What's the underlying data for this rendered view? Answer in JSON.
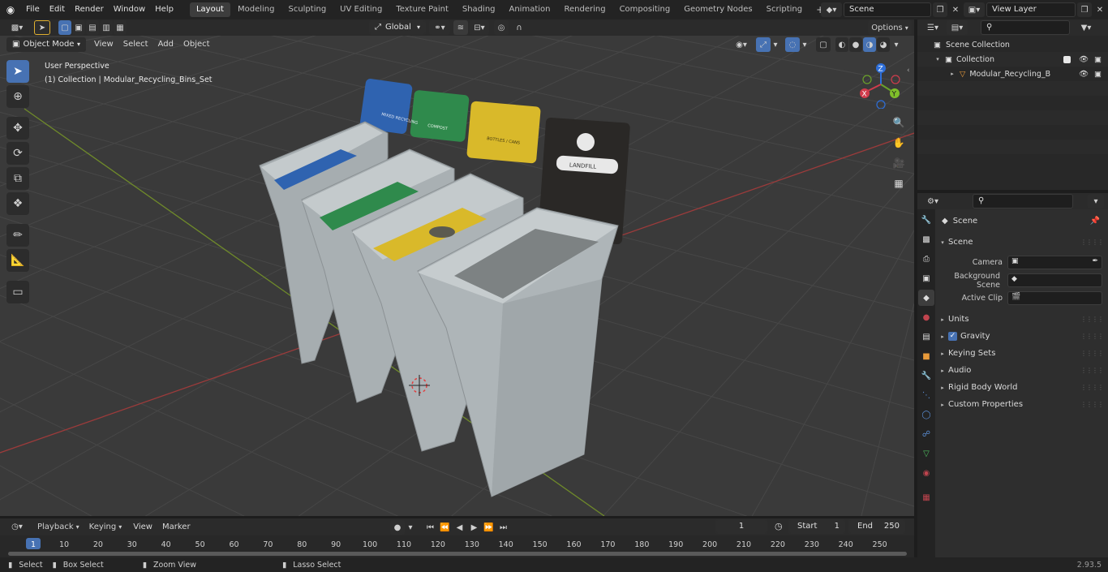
{
  "menu": {
    "items": [
      "File",
      "Edit",
      "Render",
      "Window",
      "Help"
    ]
  },
  "workspaces": {
    "tabs": [
      "Layout",
      "Modeling",
      "Sculpting",
      "UV Editing",
      "Texture Paint",
      "Shading",
      "Animation",
      "Rendering",
      "Compositing",
      "Geometry Nodes",
      "Scripting"
    ],
    "active": "Layout",
    "add_label": "+"
  },
  "scene_selector": {
    "value": "Scene"
  },
  "view_layer_selector": {
    "value": "View Layer"
  },
  "viewport_header": {
    "mode": "Object Mode",
    "menus": [
      "View",
      "Select",
      "Add",
      "Object"
    ],
    "transform_orientation": "Global",
    "options_label": "Options"
  },
  "viewport": {
    "view_name": "User Perspective",
    "collection_info": "(1) Collection | Modular_Recycling_Bins_Set",
    "gizmo": {
      "x": "X",
      "y": "Y",
      "z": "Z"
    },
    "bin_labels": {
      "recycling": "MIXED RECYCLING",
      "compost": "COMPOST",
      "bottles": "BOTTLES / CANS",
      "landfill": "LANDFILL"
    },
    "colors": {
      "blue": "#2f63b0",
      "green": "#2f8a4c",
      "yellow": "#d9b92a",
      "dark": "#2a2826",
      "bin_body": "#aab1b4"
    }
  },
  "outliner": {
    "rows": [
      {
        "label": "Scene Collection"
      },
      {
        "label": "Collection"
      },
      {
        "label": "Modular_Recycling_Bins_"
      }
    ]
  },
  "properties": {
    "context": "Scene",
    "panel_title": "Scene",
    "fields": [
      {
        "label": "Camera"
      },
      {
        "label": "Background Scene"
      },
      {
        "label": "Active Clip"
      }
    ],
    "sections": [
      "Units",
      "Gravity",
      "Keying Sets",
      "Audio",
      "Rigid Body World",
      "Custom Properties"
    ]
  },
  "timeline": {
    "menus": [
      "Playback",
      "Keying",
      "View",
      "Marker"
    ],
    "current_frame": "1",
    "start_label": "Start",
    "start_value": "1",
    "end_label": "End",
    "end_value": "250",
    "ticks": [
      "1",
      "10",
      "20",
      "30",
      "40",
      "50",
      "60",
      "70",
      "80",
      "90",
      "100",
      "110",
      "120",
      "130",
      "140",
      "150",
      "160",
      "170",
      "180",
      "190",
      "200",
      "210",
      "220",
      "230",
      "240",
      "250"
    ]
  },
  "status_bar": {
    "select": "Select",
    "box_select": "Box Select",
    "zoom_view": "Zoom View",
    "lasso_select": "Lasso Select",
    "version": "2.93.5"
  }
}
